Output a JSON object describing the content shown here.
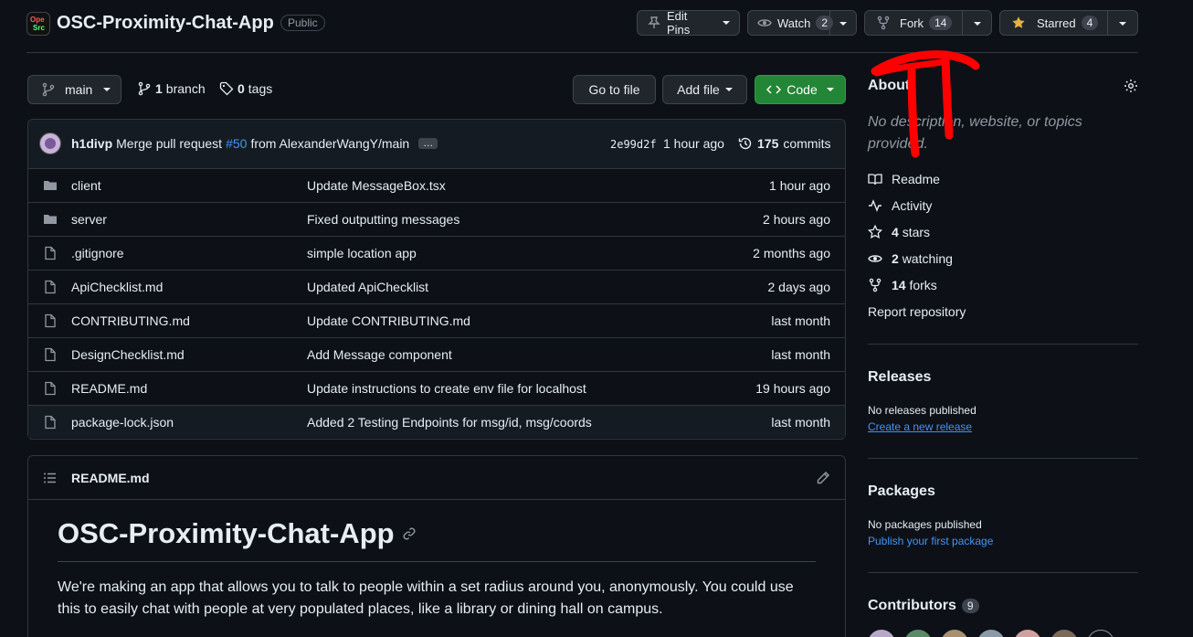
{
  "repo": {
    "name": "OSC-Proximity-Chat-App",
    "visibility": "Public"
  },
  "header_buttons": {
    "edit_pins": "Edit Pins",
    "watch": "Watch",
    "watch_count": "2",
    "fork": "Fork",
    "fork_count": "14",
    "starred": "Starred",
    "star_count": "4"
  },
  "toolbar": {
    "branch": "main",
    "branch_count": "1",
    "branch_label": "branch",
    "tag_count": "0",
    "tag_label": "tags",
    "go_to_file": "Go to file",
    "add_file": "Add file",
    "code": "Code"
  },
  "latest_commit": {
    "author": "h1divp",
    "message_prefix": "Merge pull request",
    "pr": "#50",
    "message_suffix": "from AlexanderWangY/main",
    "ellipsis": "…",
    "sha": "2e99d2f",
    "time": "1 hour ago",
    "commit_count": "175",
    "commit_label": "commits"
  },
  "files": [
    {
      "type": "folder",
      "name": "client",
      "message": "Update MessageBox.tsx",
      "time": "1 hour ago"
    },
    {
      "type": "folder",
      "name": "server",
      "message": "Fixed outputting messages",
      "time": "2 hours ago"
    },
    {
      "type": "file",
      "name": ".gitignore",
      "message": "simple location app",
      "time": "2 months ago"
    },
    {
      "type": "file",
      "name": "ApiChecklist.md",
      "message": "Updated ApiChecklist",
      "time": "2 days ago"
    },
    {
      "type": "file",
      "name": "CONTRIBUTING.md",
      "message": "Update CONTRIBUTING.md",
      "time": "last month"
    },
    {
      "type": "file",
      "name": "DesignChecklist.md",
      "message": "Add Message component",
      "time": "last month"
    },
    {
      "type": "file",
      "name": "README.md",
      "message": "Update instructions to create env file for localhost",
      "time": "19 hours ago"
    },
    {
      "type": "file",
      "name": "package-lock.json",
      "message": "Added 2 Testing Endpoints for msg/id, msg/coords",
      "time": "last month"
    }
  ],
  "readme": {
    "filename": "README.md",
    "title": "OSC-Proximity-Chat-App",
    "body": "We're making an app that allows you to talk to people within a set radius around you, anonymously. You could use this to easily chat with people at very populated places, like a library or dining hall on campus."
  },
  "about": {
    "heading": "About",
    "description": "No description, website, or topics provided.",
    "readme": "Readme",
    "activity": "Activity",
    "stars_count": "4",
    "stars_label": "stars",
    "watching_count": "2",
    "watching_label": "watching",
    "forks_count": "14",
    "forks_label": "forks",
    "report": "Report repository"
  },
  "releases": {
    "heading": "Releases",
    "none": "No releases published",
    "create": "Create a new release"
  },
  "packages": {
    "heading": "Packages",
    "none": "No packages published",
    "publish": "Publish your first package"
  },
  "contributors": {
    "heading": "Contributors",
    "count": "9"
  },
  "colors": {
    "background": "#0d1117",
    "code_button": "#238636",
    "link": "#4493f8",
    "annotation": "#ff0000"
  }
}
